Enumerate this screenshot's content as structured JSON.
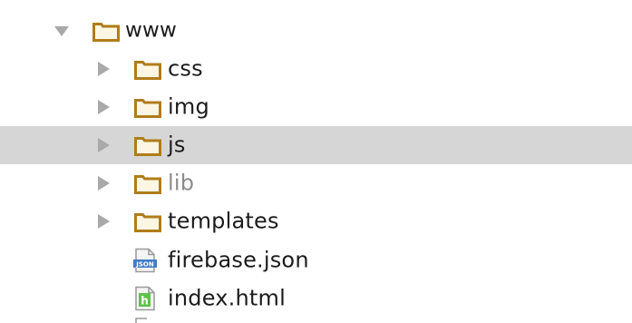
{
  "tree": {
    "root": {
      "label": "www",
      "icon": "folder-icon",
      "expanded": true
    },
    "children": [
      {
        "label": "css",
        "type": "folder",
        "icon": "folder-icon",
        "expanded": false
      },
      {
        "label": "img",
        "type": "folder",
        "icon": "folder-icon",
        "expanded": false
      },
      {
        "label": "js",
        "type": "folder",
        "icon": "folder-icon",
        "expanded": false,
        "selected": true
      },
      {
        "label": "lib",
        "type": "folder",
        "icon": "folder-icon",
        "expanded": false,
        "excluded": true
      },
      {
        "label": "templates",
        "type": "folder",
        "icon": "folder-icon",
        "expanded": false
      },
      {
        "label": "firebase.json",
        "type": "file",
        "icon": "json-file-icon",
        "badge": "JSON"
      },
      {
        "label": "index.html",
        "type": "file",
        "icon": "html-file-icon",
        "badge": "h"
      }
    ]
  },
  "colors": {
    "folder_outline": "#b07d1a",
    "folder_fill": "#fdf6e3",
    "selection_bg": "#d6d6d6",
    "arrow": "#a9a9a9",
    "muted_text": "#8c8c8c",
    "html_badge": "#5fc24a",
    "json_badge": "#3f7ec7"
  }
}
